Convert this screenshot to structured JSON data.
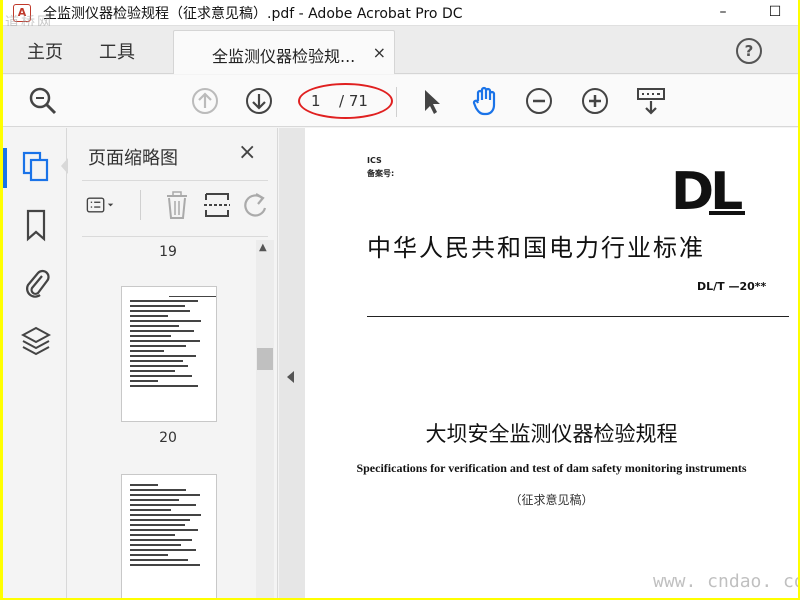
{
  "window": {
    "title": "全监测仪器检验规程（征求意见稿）.pdf - Adobe Acrobat Pro DC",
    "minimize": "–",
    "maximize": "☐",
    "watermark": "道桥网"
  },
  "menubar": {
    "home": "主页",
    "tools": "工具",
    "tab_label": "全监测仪器检验规...",
    "tab_close": "×",
    "help": "?"
  },
  "toolbar": {
    "page_current": "1",
    "page_total": "/ 71"
  },
  "thumbnails": {
    "title": "页面缩略图",
    "close": "×",
    "pages": [
      {
        "label": "19"
      },
      {
        "label": "20"
      }
    ]
  },
  "document": {
    "ics": "ICS",
    "beian": "备案号:",
    "logo": "DL",
    "standard_title": "中华人民共和国电力行业标准",
    "standard_no": "DL/T  —20**",
    "cn_title": "大坝安全监测仪器检验规程",
    "en_title": "Specifications for verification and test of dam safety monitoring instruments",
    "draft": "（征求意见稿）",
    "watermark": "www. cndao. com"
  },
  "colors": {
    "accent": "#1a73e8",
    "highlight": "#e02020",
    "border": "#ffff00"
  }
}
